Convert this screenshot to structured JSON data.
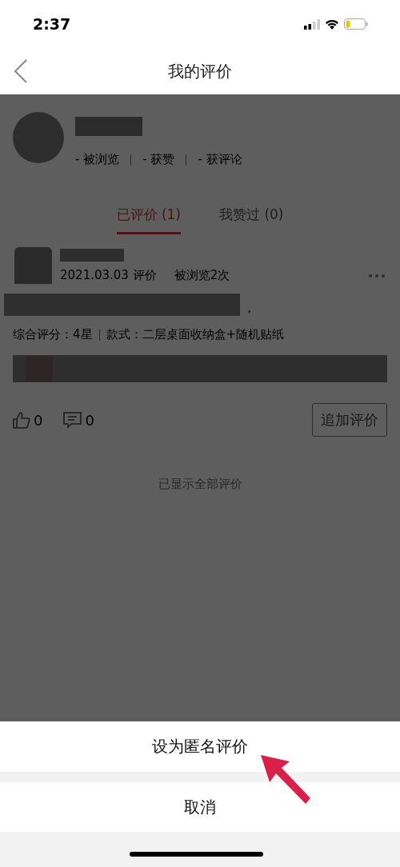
{
  "status_bar": {
    "time": "2:37"
  },
  "nav": {
    "title": "我的评价"
  },
  "profile": {
    "stats": [
      {
        "value": "-",
        "label": "被浏览"
      },
      {
        "value": "-",
        "label": "获赞"
      },
      {
        "value": "-",
        "label": "获评论"
      }
    ]
  },
  "tabs": [
    {
      "label": "已评价",
      "count": "(1)",
      "selected": true
    },
    {
      "label": "我赞过",
      "count": "(0)",
      "selected": false
    }
  ],
  "review": {
    "date": "2021.03.03 评价",
    "views": "被浏览2次",
    "text_tail": "，",
    "rating": "综合评分：4星",
    "variant": "款式：二层桌面收纳盒+随机贴纸",
    "likes": "0",
    "comments": "0",
    "button": "追加评价"
  },
  "footer": "已显示全部评价",
  "action_sheet": {
    "actions": [
      "设为匿名评价"
    ],
    "cancel": "取消"
  }
}
